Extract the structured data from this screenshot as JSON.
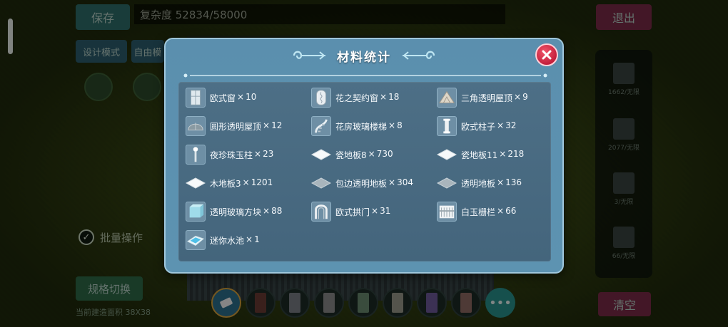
{
  "background": {
    "save_label": "保存",
    "complexity_text": "复杂度 52834/58000",
    "exit_label": "退出",
    "design_mode_label": "设计模式",
    "free_label": "自由模",
    "batch_label": "批量操作",
    "spec_switch_label": "规格切换",
    "spec_note": "当前建造面积 38X38",
    "clear_label": "清空",
    "right_panel_counts": [
      "1662/无限",
      "2077/无限",
      "3/无限",
      "66/无限"
    ]
  },
  "modal": {
    "title": "材料统计",
    "materials": [
      {
        "name": "欧式窗",
        "qty": "10",
        "icon": "window-icon"
      },
      {
        "name": "花之契约窗",
        "qty": "18",
        "icon": "flower-window-icon"
      },
      {
        "name": "三角透明屋顶",
        "qty": "9",
        "icon": "triangle-roof-icon"
      },
      {
        "name": "圆形透明屋顶",
        "qty": "12",
        "icon": "dome-roof-icon"
      },
      {
        "name": "花房玻璃楼梯",
        "qty": "8",
        "icon": "glass-stairs-icon"
      },
      {
        "name": "欧式柱子",
        "qty": "32",
        "icon": "pillar-icon"
      },
      {
        "name": "夜珍珠玉柱",
        "qty": "23",
        "icon": "pearl-pillar-icon"
      },
      {
        "name": "瓷地板8",
        "qty": "730",
        "icon": "white-tile-icon"
      },
      {
        "name": "瓷地板11",
        "qty": "218",
        "icon": "white-tile-icon"
      },
      {
        "name": "木地板3",
        "qty": "1201",
        "icon": "white-tile-icon"
      },
      {
        "name": "包边透明地板",
        "qty": "304",
        "icon": "grey-tile-icon"
      },
      {
        "name": "透明地板",
        "qty": "136",
        "icon": "grey-tile-icon"
      },
      {
        "name": "透明玻璃方块",
        "qty": "88",
        "icon": "glass-block-icon"
      },
      {
        "name": "欧式拱门",
        "qty": "31",
        "icon": "arch-door-icon"
      },
      {
        "name": "白玉栅栏",
        "qty": "66",
        "icon": "fence-icon"
      },
      {
        "name": "迷你水池",
        "qty": "1",
        "icon": "pool-icon"
      }
    ],
    "times_sign": "×"
  },
  "colors": {
    "modal_bg": "#5b8fae",
    "content_bg": "#4d6f86",
    "close_red": "#c41f3c",
    "text": "#f4f8fb"
  }
}
